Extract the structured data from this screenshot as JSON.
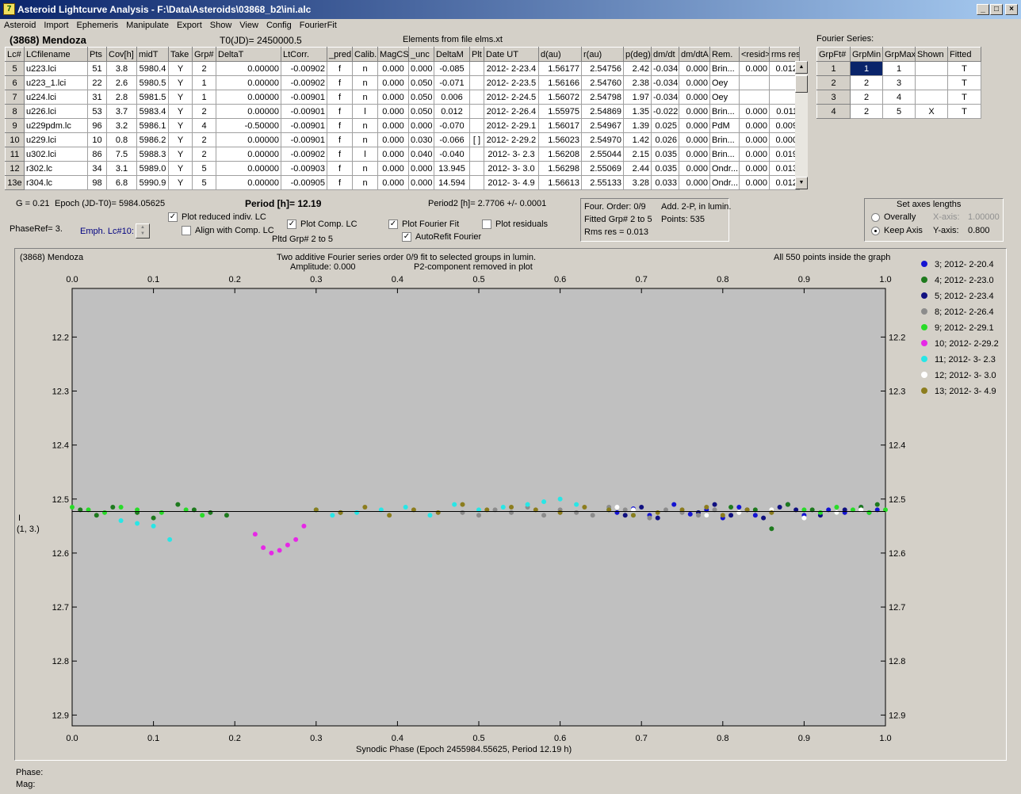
{
  "window": {
    "title": "Asteroid Lightcurve Analysis - F:\\Data\\Asteroids\\03868_b2\\ini.alc"
  },
  "menu": [
    "Asteroid",
    "Import",
    "Ephemeris",
    "Manipulate",
    "Export",
    "Show",
    "View",
    "Config",
    "FourierFit"
  ],
  "header": {
    "asteroid": "(3868) Mendoza",
    "t0": "T0(JD)= 2450000.5",
    "elements": "Elements from file elms.xt"
  },
  "table": {
    "columns": [
      "Lc#",
      "LCfilename",
      "Pts",
      "Cov[h]",
      "midT",
      "Take",
      "Grp#",
      "DeltaT",
      "LtCorr.",
      "_pred.",
      "Calib.",
      "MagCS",
      "_unc",
      "DeltaM",
      "Plt",
      "Date UT",
      "d(au)",
      "r(au)",
      "p(deg)",
      "dm/dt",
      "dm/dtA",
      "Rem.",
      "<resid>",
      "rms res"
    ],
    "rows": [
      [
        "5",
        "u223.lci",
        "51",
        "3.8",
        "5980.4",
        "Y",
        "2",
        "0.00000",
        "-0.00902",
        "f",
        "n",
        "0.000",
        "0.000",
        "-0.085",
        "",
        "2012- 2-23.4",
        "1.56177",
        "2.54756",
        "2.42",
        "-0.034",
        "0.000",
        "Brin...",
        "0.000",
        "0.012"
      ],
      [
        "6",
        "u223_1.lci",
        "22",
        "2.6",
        "5980.5",
        "Y",
        "1",
        "0.00000",
        "-0.00902",
        "f",
        "n",
        "0.000",
        "0.050",
        "-0.071",
        "",
        "2012- 2-23.5",
        "1.56166",
        "2.54760",
        "2.38",
        "-0.034",
        "0.000",
        "Oey",
        "",
        ""
      ],
      [
        "7",
        "u224.lci",
        "31",
        "2.8",
        "5981.5",
        "Y",
        "1",
        "0.00000",
        "-0.00901",
        "f",
        "n",
        "0.000",
        "0.050",
        "0.006",
        "",
        "2012- 2-24.5",
        "1.56072",
        "2.54798",
        "1.97",
        "-0.034",
        "0.000",
        "Oey",
        "",
        ""
      ],
      [
        "8",
        "u226.lci",
        "53",
        "3.7",
        "5983.4",
        "Y",
        "2",
        "0.00000",
        "-0.00901",
        "f",
        "l",
        "0.000",
        "0.050",
        "0.012",
        "",
        "2012- 2-26.4",
        "1.55975",
        "2.54869",
        "1.35",
        "-0.022",
        "0.000",
        "Brin...",
        "0.000",
        "0.011"
      ],
      [
        "9",
        "u229pdm.lc",
        "96",
        "3.2",
        "5986.1",
        "Y",
        "4",
        "-0.50000",
        "-0.00901",
        "f",
        "n",
        "0.000",
        "0.000",
        "-0.070",
        "",
        "2012- 2-29.1",
        "1.56017",
        "2.54967",
        "1.39",
        "0.025",
        "0.000",
        "PdM",
        "0.000",
        "0.009"
      ],
      [
        "10",
        "u229.lci",
        "10",
        "0.8",
        "5986.2",
        "Y",
        "2",
        "0.00000",
        "-0.00901",
        "f",
        "n",
        "0.000",
        "0.030",
        "-0.066",
        "[ ]",
        "2012- 2-29.2",
        "1.56023",
        "2.54970",
        "1.42",
        "0.026",
        "0.000",
        "Brin...",
        "0.000",
        "0.000"
      ],
      [
        "11",
        "u302.lci",
        "86",
        "7.5",
        "5988.3",
        "Y",
        "2",
        "0.00000",
        "-0.00902",
        "f",
        "l",
        "0.000",
        "0.040",
        "-0.040",
        "",
        "2012- 3- 2.3",
        "1.56208",
        "2.55044",
        "2.15",
        "0.035",
        "0.000",
        "Brin...",
        "0.000",
        "0.019"
      ],
      [
        "12",
        "r302.lc",
        "34",
        "3.1",
        "5989.0",
        "Y",
        "5",
        "0.00000",
        "-0.00903",
        "f",
        "n",
        "0.000",
        "0.000",
        "13.945",
        "",
        "2012- 3- 3.0",
        "1.56298",
        "2.55069",
        "2.44",
        "0.035",
        "0.000",
        "Ondr...",
        "0.000",
        "0.013"
      ],
      [
        "13e",
        "r304.lc",
        "98",
        "6.8",
        "5990.9",
        "Y",
        "5",
        "0.00000",
        "-0.00905",
        "f",
        "n",
        "0.000",
        "0.000",
        "14.594",
        "",
        "2012- 3- 4.9",
        "1.56613",
        "2.55133",
        "3.28",
        "0.033",
        "0.000",
        "Ondr...",
        "0.000",
        "0.012"
      ]
    ]
  },
  "fourier": {
    "label": "Fourier Series:",
    "columns": [
      "GrpFt#",
      "GrpMin",
      "GrpMax",
      "Shown",
      "Fitted"
    ],
    "rows": [
      [
        "1",
        "1",
        "1",
        "",
        "T"
      ],
      [
        "2",
        "2",
        "3",
        "",
        "T"
      ],
      [
        "3",
        "2",
        "4",
        "",
        "T"
      ],
      [
        "4",
        "2",
        "5",
        "X",
        "T"
      ]
    ]
  },
  "params": {
    "g": "G = 0.21",
    "epoch": "Epoch (JD-T0)= 5984.05625",
    "period": "Period [h]= 12.19",
    "period2": "Period2 [h]= 2.7706 +/- 0.0001",
    "phaseref": "PhaseRef= 3.",
    "emph": "Emph. Lc#10:",
    "pltd": "Pltd Grp#  2   to   5"
  },
  "options": {
    "plot_reduced": "Plot reduced indiv. LC",
    "align": "Align with Comp. LC",
    "plot_comp": "Plot Comp. LC",
    "plot_fourier": "Plot Fourier Fit",
    "autorefit": "AutoRefit Fourier",
    "plot_resid": "Plot residuals"
  },
  "fitinfo": {
    "order": "Four. Order:  0/9",
    "add": "Add. 2-P, in lumin.",
    "fitted": "Fitted Grp# 2 to 5",
    "points": "Points: 535",
    "rms": "Rms res      = 0.013"
  },
  "axes": {
    "label": "Set axes lengths",
    "overally": "Overally",
    "keep": "Keep Axis",
    "xaxis_lbl": "X-axis:",
    "xaxis_val": "1.00000",
    "yaxis_lbl": "Y-axis:",
    "yaxis_val": "0.800"
  },
  "plot": {
    "topleft": "(3868) Mendoza",
    "caption1": "Two additive Fourier series order 0/9 fit to selected groups in lumin.",
    "caption2": "Amplitude: 0.000",
    "caption3": "P2-component removed in plot",
    "allpts": "All 550 points inside the graph",
    "ylabel1": "I",
    "ylabel2": "(1, 3.)",
    "xlabel": "Synodic Phase (Epoch 2455984.55625, Period 12.19 h)"
  },
  "chart_data": {
    "type": "scatter",
    "xlim": [
      0,
      1
    ],
    "ylim": [
      12.92,
      12.11
    ],
    "xticks": [
      "0.0",
      "0.1",
      "0.2",
      "0.3",
      "0.4",
      "0.5",
      "0.6",
      "0.7",
      "0.8",
      "0.9",
      "1.0"
    ],
    "yticks": [
      "12.2",
      "12.3",
      "12.4",
      "12.5",
      "12.6",
      "12.7",
      "12.8",
      "12.9"
    ],
    "fit_y": 12.523,
    "series": [
      {
        "name": "3; 2012- 2-20.4",
        "color": "#1414d2",
        "x": [
          0.67,
          0.69,
          0.71,
          0.74,
          0.76,
          0.78,
          0.8,
          0.82,
          0.84,
          0.86,
          0.88,
          0.9,
          0.93,
          0.95,
          0.97,
          0.99
        ],
        "y": [
          12.525,
          12.518,
          12.53,
          12.51,
          12.528,
          12.52,
          12.535,
          12.515,
          12.53,
          12.522,
          12.51,
          12.53,
          12.52,
          12.525,
          12.515,
          12.52
        ]
      },
      {
        "name": "4; 2012- 2-23.0",
        "color": "#1e7a1e",
        "x": [
          0.01,
          0.03,
          0.05,
          0.08,
          0.1,
          0.13,
          0.15,
          0.17,
          0.19,
          0.3,
          0.33,
          0.78,
          0.81,
          0.84,
          0.86,
          0.88,
          0.91,
          0.94,
          0.97,
          0.99
        ],
        "y": [
          12.52,
          12.53,
          12.515,
          12.525,
          12.535,
          12.51,
          12.52,
          12.525,
          12.53,
          12.52,
          12.525,
          12.53,
          12.515,
          12.52,
          12.555,
          12.51,
          12.52,
          12.525,
          12.515,
          12.51
        ]
      },
      {
        "name": "5; 2012- 2-23.4",
        "color": "#101080",
        "x": [
          0.66,
          0.68,
          0.7,
          0.72,
          0.75,
          0.77,
          0.79,
          0.81,
          0.83,
          0.85,
          0.87,
          0.89,
          0.92,
          0.95,
          0.98
        ],
        "y": [
          12.52,
          12.53,
          12.515,
          12.535,
          12.52,
          12.525,
          12.51,
          12.53,
          12.52,
          12.535,
          12.515,
          12.52,
          12.53,
          12.52,
          12.525
        ]
      },
      {
        "name": "8; 2012- 2-26.4",
        "color": "#8c8c8c",
        "x": [
          0.48,
          0.5,
          0.52,
          0.54,
          0.56,
          0.58,
          0.6,
          0.62,
          0.64,
          0.66,
          0.68,
          0.71,
          0.73,
          0.75,
          0.77,
          0.79
        ],
        "y": [
          12.525,
          12.53,
          12.52,
          12.525,
          12.515,
          12.53,
          12.52,
          12.525,
          12.53,
          12.515,
          12.52,
          12.535,
          12.52,
          12.525,
          12.53,
          12.52
        ]
      },
      {
        "name": "9; 2012- 2-29.1",
        "color": "#28dc28",
        "x": [
          0.0,
          0.02,
          0.04,
          0.06,
          0.08,
          0.11,
          0.14,
          0.16,
          0.9,
          0.92,
          0.94,
          0.96,
          0.98,
          1.0
        ],
        "y": [
          12.515,
          12.52,
          12.525,
          12.515,
          12.52,
          12.525,
          12.52,
          12.53,
          12.52,
          12.525,
          12.515,
          12.52,
          12.525,
          12.52
        ]
      },
      {
        "name": "10; 2012- 2-29.2",
        "color": "#e628e6",
        "x": [
          0.225,
          0.235,
          0.245,
          0.255,
          0.265,
          0.275,
          0.285
        ],
        "y": [
          12.565,
          12.59,
          12.6,
          12.595,
          12.585,
          12.575,
          12.55
        ]
      },
      {
        "name": "11; 2012- 3- 2.3",
        "color": "#28e6e6",
        "x": [
          0.06,
          0.08,
          0.1,
          0.12,
          0.3,
          0.32,
          0.35,
          0.38,
          0.41,
          0.44,
          0.47,
          0.5,
          0.53,
          0.56,
          0.58,
          0.6,
          0.62,
          0.66,
          0.69
        ],
        "y": [
          12.54,
          12.545,
          12.55,
          12.575,
          12.52,
          12.53,
          12.525,
          12.52,
          12.515,
          12.53,
          12.51,
          12.52,
          12.515,
          12.51,
          12.505,
          12.5,
          12.51,
          12.52,
          12.53
        ]
      },
      {
        "name": "12; 2012- 3- 3.0",
        "color": "#ffffff",
        "x": [
          0.67,
          0.69,
          0.72,
          0.75,
          0.78,
          0.82,
          0.86,
          0.9,
          0.94,
          0.97
        ],
        "y": [
          12.515,
          12.52,
          12.525,
          12.52,
          12.53,
          12.525,
          12.52,
          12.535,
          12.525,
          12.52
        ]
      },
      {
        "name": "13; 2012- 3- 4.9",
        "color": "#8c7d1e",
        "x": [
          0.3,
          0.33,
          0.36,
          0.39,
          0.42,
          0.45,
          0.48,
          0.51,
          0.54,
          0.57,
          0.6,
          0.63,
          0.66,
          0.69,
          0.72,
          0.75,
          0.78,
          0.8,
          0.83,
          0.86
        ],
        "y": [
          12.52,
          12.525,
          12.515,
          12.53,
          12.52,
          12.525,
          12.51,
          12.52,
          12.515,
          12.52,
          12.525,
          12.515,
          12.52,
          12.53,
          12.525,
          12.52,
          12.515,
          12.53,
          12.52,
          12.525
        ]
      }
    ]
  },
  "status": {
    "phase": "Phase:",
    "mag": "Mag:"
  }
}
